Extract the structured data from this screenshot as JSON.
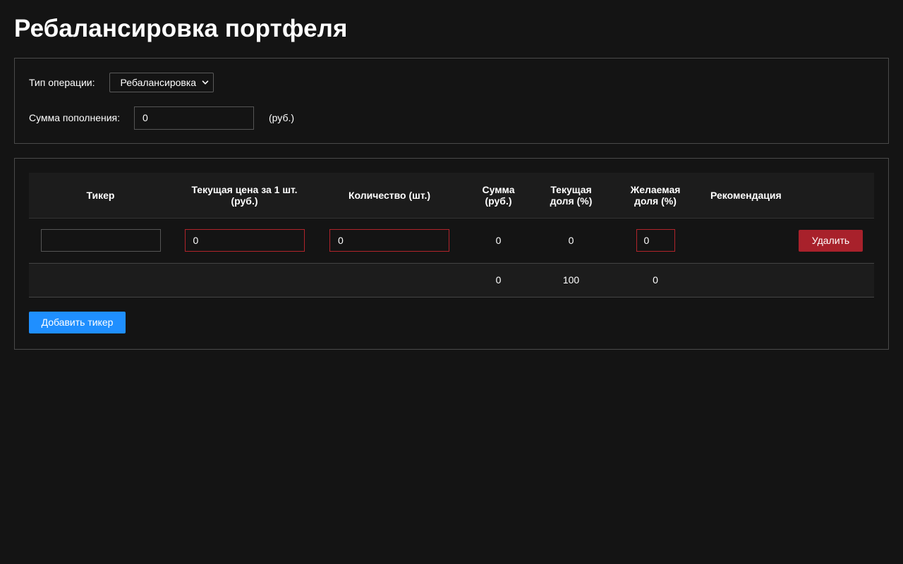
{
  "page": {
    "title": "Ребалансировка портфеля"
  },
  "settings": {
    "operation_label": "Тип операции:",
    "operation_value": "Ребалансировка",
    "deposit_label": "Сумма пополнения:",
    "deposit_value": "0",
    "deposit_unit": "(руб.)"
  },
  "table": {
    "headers": {
      "ticker": "Тикер",
      "price": "Текущая цена за 1 шт. (руб.)",
      "quantity": "Количество (шт.)",
      "sum": "Сумма (руб.)",
      "current_share": "Текущая доля (%)",
      "desired_share": "Желаемая доля (%)",
      "recommendation": "Рекомендация"
    },
    "rows": [
      {
        "ticker": "",
        "price": "0",
        "quantity": "0",
        "sum": "0",
        "current_share": "0",
        "desired_share": "0",
        "recommendation": "",
        "delete_label": "Удалить"
      }
    ],
    "totals": {
      "sum": "0",
      "current_share": "100",
      "desired_share": "0"
    }
  },
  "actions": {
    "add_ticker_label": "Добавить тикер"
  },
  "colors": {
    "background": "#141414",
    "danger": "#a8212b",
    "primary": "#1f8fff",
    "error_border": "#b0242b"
  },
  "icons": {
    "select_arrow": "chevron-down-icon"
  }
}
